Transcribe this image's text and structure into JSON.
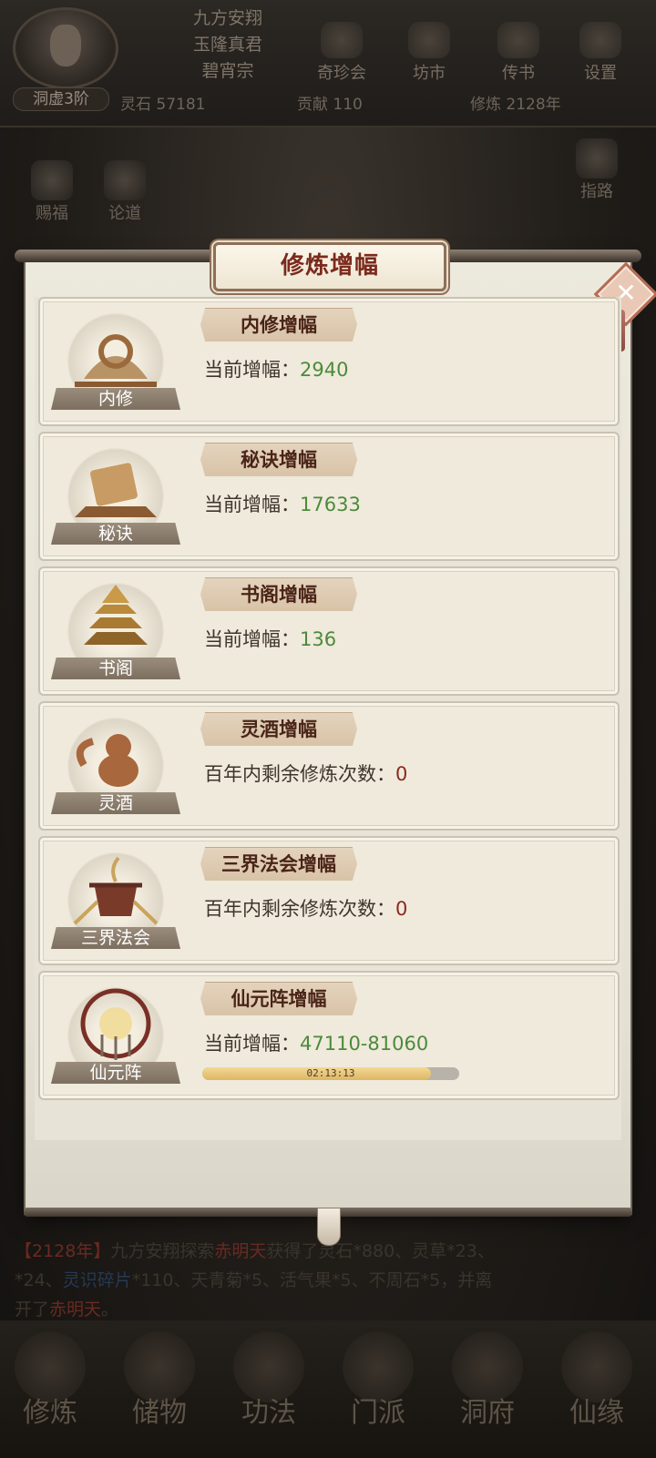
{
  "player": {
    "names": [
      "九方安翔",
      "玉隆真君",
      "碧宵宗"
    ],
    "rank": "洞虚3阶"
  },
  "top_menu": [
    "奇珍会",
    "坊市",
    "传书",
    "设置"
  ],
  "stats": {
    "lingshi": "灵石 57181",
    "gongxian": "贡献 110",
    "xiulian": "修炼 2128年"
  },
  "side_left": [
    "赐福",
    "论道"
  ],
  "side_right": [
    "指路"
  ],
  "modal": {
    "title": "修炼增幅",
    "close_label": "✕",
    "cards": [
      {
        "emblem": "内修",
        "badge": "内修增幅",
        "label": "当前增幅：",
        "value": "2940",
        "value_color": "green"
      },
      {
        "emblem": "秘诀",
        "badge": "秘诀增幅",
        "label": "当前增幅：",
        "value": "17633",
        "value_color": "green"
      },
      {
        "emblem": "书阁",
        "badge": "书阁增幅",
        "label": "当前增幅：",
        "value": "136",
        "value_color": "green"
      },
      {
        "emblem": "灵酒",
        "badge": "灵酒增幅",
        "label": "百年内剩余修炼次数：",
        "value": "0",
        "value_color": "red"
      },
      {
        "emblem": "三界法会",
        "badge": "三界法会增幅",
        "label": "百年内剩余修炼次数：",
        "value": "0",
        "value_color": "red"
      },
      {
        "emblem": "仙元阵",
        "badge": "仙元阵增幅",
        "label": "当前增幅：",
        "value": "47110-81060",
        "value_color": "green",
        "timer": "02:13:13",
        "progress": 0.89
      }
    ]
  },
  "log": {
    "year": "【2128年】",
    "text1": "九方安翔探索",
    "place": "赤明天",
    "text2": "获得了",
    "items": "灵石*880、灵草*23、",
    "line2a": "*24、",
    "item_blue": "灵识碎片",
    "line2b": "*110、天青菊*5、活气果*5、不周石*5，并离",
    "line3a": "开了",
    "line3b": "赤明天",
    "line3c": "。"
  },
  "bottom_nav": [
    "修炼",
    "储物",
    "功法",
    "门派",
    "洞府",
    "仙缘"
  ],
  "colors": {
    "accent_red": "#7a2a1c",
    "value_green": "#4c8a3a",
    "value_red": "#8a2a20",
    "badge": "#d8c3a7"
  }
}
